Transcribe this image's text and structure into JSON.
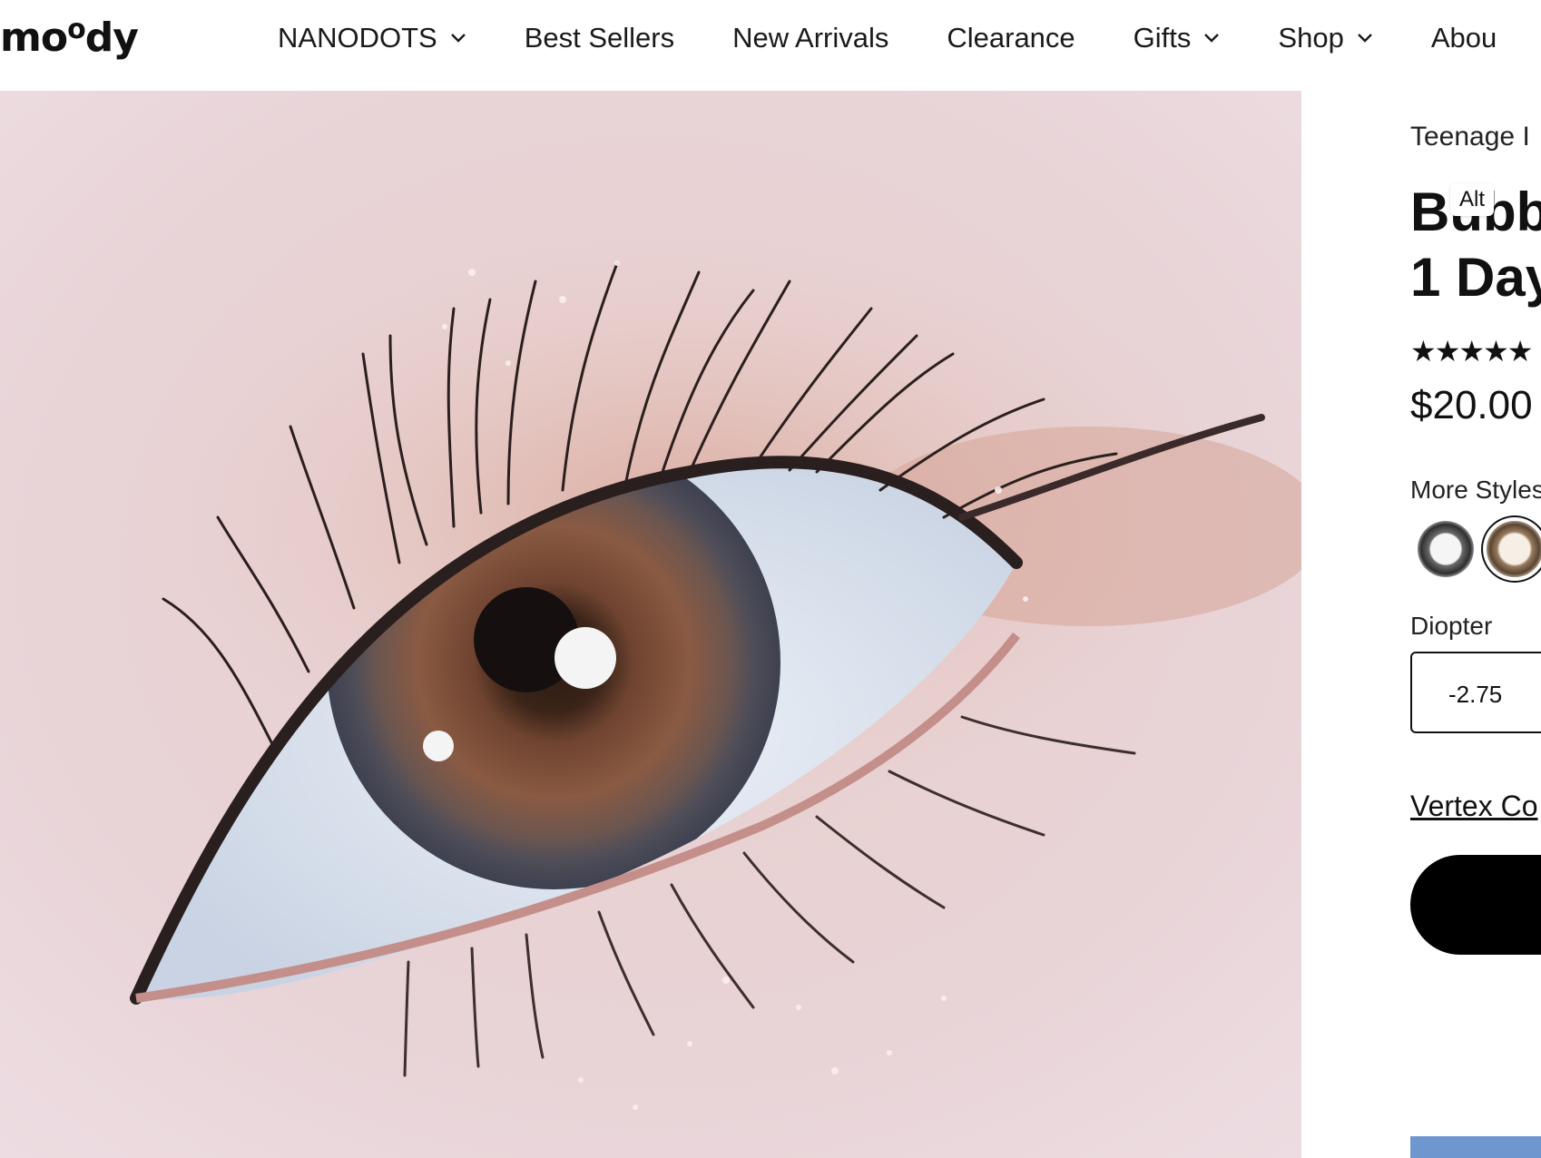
{
  "header": {
    "logo_main": "mo",
    "logo_sup": "o",
    "logo_end": "dy",
    "nav": [
      {
        "label": "NANODOTS",
        "has_dropdown": true
      },
      {
        "label": "Best Sellers",
        "has_dropdown": false
      },
      {
        "label": "New Arrivals",
        "has_dropdown": false
      },
      {
        "label": "Clearance",
        "has_dropdown": false
      },
      {
        "label": "Gifts",
        "has_dropdown": true
      },
      {
        "label": "Shop",
        "has_dropdown": true
      },
      {
        "label": "Abou",
        "has_dropdown": false
      }
    ]
  },
  "product": {
    "collection": "Teenage I",
    "title_line1": "Bubb",
    "title_line2": "1 Day",
    "alt_tooltip": "Alt",
    "rating_stars": "★★★★★",
    "price": "$20.00",
    "more_styles_label": "More Styles",
    "styles": [
      "grey-ring-lens",
      "brown-ring-lens"
    ],
    "diopter_label": "Diopter",
    "diopter_value": "-2.75",
    "vertex_link": "Vertex Co"
  },
  "colors": {
    "accent": "#000000",
    "promo": "#6f97cf"
  }
}
